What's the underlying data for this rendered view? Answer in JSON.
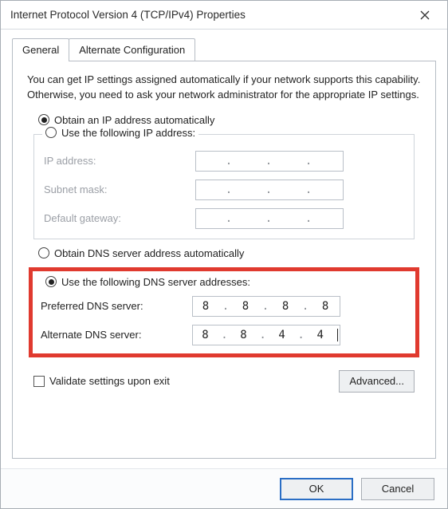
{
  "window": {
    "title": "Internet Protocol Version 4 (TCP/IPv4) Properties"
  },
  "tabs": {
    "general": "General",
    "alternate": "Alternate Configuration"
  },
  "intro": "You can get IP settings assigned automatically if your network supports this capability. Otherwise, you need to ask your network administrator for the appropriate IP settings.",
  "ip": {
    "auto_label": "Obtain an IP address automatically",
    "manual_label": "Use the following IP address:",
    "auto_selected": true,
    "fields": {
      "address_label": "IP address:",
      "subnet_label": "Subnet mask:",
      "gateway_label": "Default gateway:",
      "address": [
        "",
        "",
        "",
        ""
      ],
      "subnet": [
        "",
        "",
        "",
        ""
      ],
      "gateway": [
        "",
        "",
        "",
        ""
      ]
    }
  },
  "dns": {
    "auto_label": "Obtain DNS server address automatically",
    "manual_label": "Use the following DNS server addresses:",
    "manual_selected": true,
    "fields": {
      "preferred_label": "Preferred DNS server:",
      "alternate_label": "Alternate DNS server:",
      "preferred": [
        "8",
        "8",
        "8",
        "8"
      ],
      "alternate": [
        "8",
        "8",
        "4",
        "4"
      ]
    }
  },
  "validate_label": "Validate settings upon exit",
  "advanced_label": "Advanced...",
  "buttons": {
    "ok": "OK",
    "cancel": "Cancel"
  }
}
